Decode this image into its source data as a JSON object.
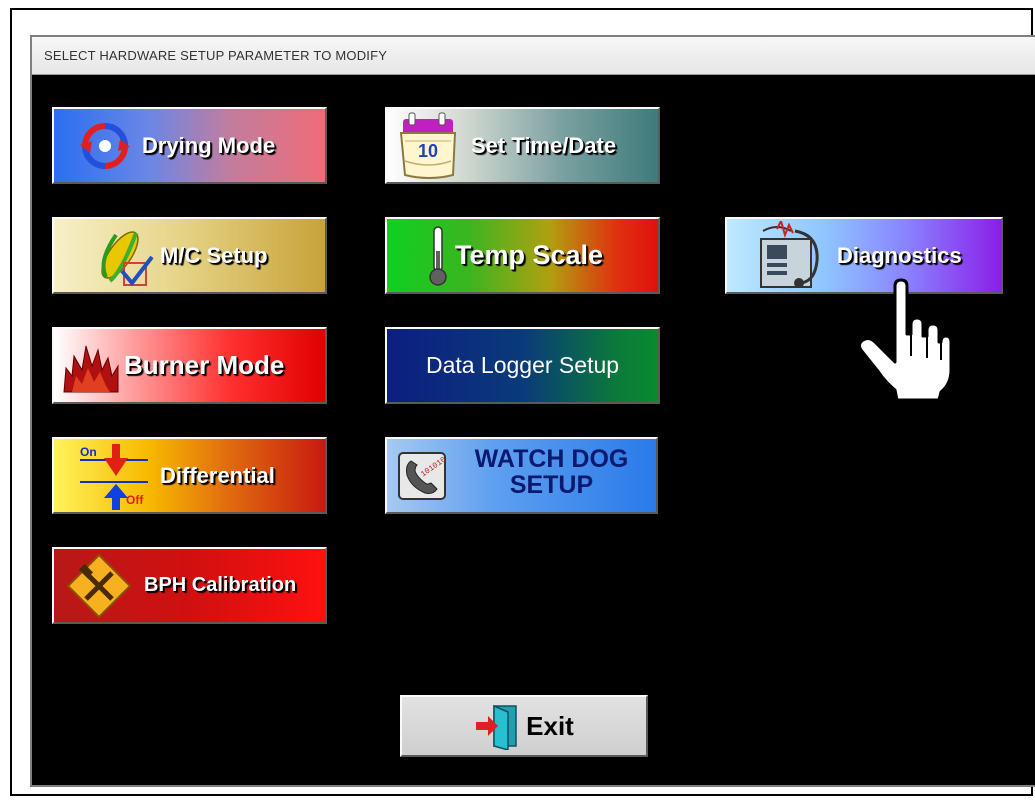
{
  "window": {
    "title": "SELECT HARDWARE SETUP PARAMETER TO MODIFY"
  },
  "buttons": {
    "drying_mode": {
      "label": "Drying Mode",
      "icon": "refresh-arrows-icon"
    },
    "mc_setup": {
      "label": "M/C Setup",
      "icon": "corn-checkbox-icon"
    },
    "burner_mode": {
      "label": "Burner Mode",
      "icon": "fire-icon"
    },
    "differential": {
      "label": "Differential",
      "icon": "on-off-arrows-icon",
      "icon_on": "On",
      "icon_off": "Off"
    },
    "bph_calibration": {
      "label": "BPH Calibration",
      "icon": "tools-diamond-icon"
    },
    "set_time_date": {
      "label": "Set Time/Date",
      "icon": "calendar-icon",
      "icon_day": "10"
    },
    "temp_scale": {
      "label": "Temp Scale",
      "icon": "thermometer-icon"
    },
    "data_logger_setup": {
      "label": "Data Logger Setup"
    },
    "watch_dog_setup": {
      "label_line1": "WATCH DOG",
      "label_line2": "SETUP",
      "icon": "phone-binary-icon",
      "icon_text": "101010"
    },
    "diagnostics": {
      "label": "Diagnostics",
      "icon": "stethoscope-monitor-icon"
    },
    "exit": {
      "label": "Exit",
      "icon": "exit-door-icon"
    }
  },
  "cursor": {
    "icon": "pointing-hand-icon"
  },
  "colors": {
    "background": "#000000",
    "title_bar": "#eeeeee",
    "button_text": "#ffffff"
  }
}
